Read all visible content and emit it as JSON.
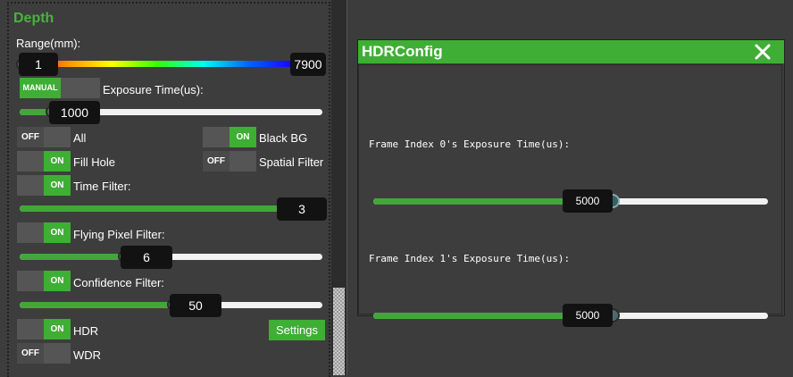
{
  "depth_panel": {
    "title": "Depth",
    "range": {
      "label": "Range(mm):",
      "min_value": "1",
      "max_value": "7900"
    },
    "exposure": {
      "mode_toggle": "MANUAL",
      "label": "Exposure Time(us):",
      "value": "1000",
      "fraction": 0.1
    },
    "toggles": {
      "all": {
        "state": "OFF",
        "label": "All"
      },
      "black_bg": {
        "state": "ON",
        "label": "Black BG"
      },
      "fill_hole": {
        "state": "ON",
        "label": "Fill Hole"
      },
      "spatial_filter": {
        "state": "OFF",
        "label": "Spatial Filter"
      },
      "time_filter": {
        "state": "ON",
        "label": "Time Filter:"
      },
      "flying_pixel": {
        "state": "ON",
        "label": "Flying Pixel Filter:"
      },
      "confidence": {
        "state": "ON",
        "label": "Confidence Filter:"
      },
      "hdr": {
        "state": "ON",
        "label": "HDR"
      },
      "wdr": {
        "state": "OFF",
        "label": "WDR"
      }
    },
    "time_filter_slider": {
      "value": "3",
      "fraction": 1.0
    },
    "flying_pixel_slider": {
      "value": "6",
      "fraction": 0.33
    },
    "confidence_slider": {
      "value": "50",
      "fraction": 0.5
    },
    "settings_button": "Settings"
  },
  "hdr_config": {
    "title": "HDRConfig",
    "close_icon": "close-icon",
    "frame0": {
      "label": "Frame Index 0's Exposure Time(us):",
      "value": "5000",
      "fraction": 0.6
    },
    "frame1": {
      "label": "Frame Index 1's Exposure Time(us):",
      "value": "5000",
      "fraction": 0.6
    }
  },
  "colors": {
    "accent": "#3fae35",
    "background": "#3c3c3c",
    "title_green": "#49b23d"
  }
}
